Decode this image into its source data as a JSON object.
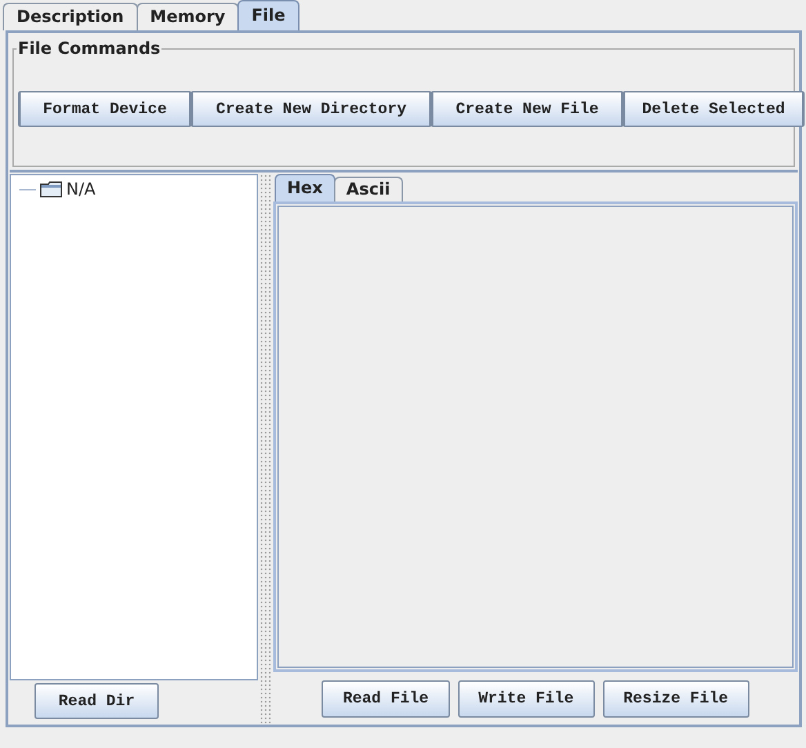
{
  "tabs": [
    {
      "label": "Description",
      "selected": false
    },
    {
      "label": "Memory",
      "selected": false
    },
    {
      "label": "File",
      "selected": true
    }
  ],
  "file_commands": {
    "title": "File Commands",
    "buttons": [
      "Format Device",
      "Create New Directory",
      "Create New File",
      "Delete Selected"
    ]
  },
  "tree": {
    "items": [
      {
        "label": "N/A"
      }
    ]
  },
  "tree_buttons": [
    "Read Dir"
  ],
  "viewer_tabs": [
    {
      "label": "Hex",
      "selected": true
    },
    {
      "label": "Ascii",
      "selected": false
    }
  ],
  "file_buttons": [
    "Read File",
    "Write File",
    "Resize File"
  ]
}
